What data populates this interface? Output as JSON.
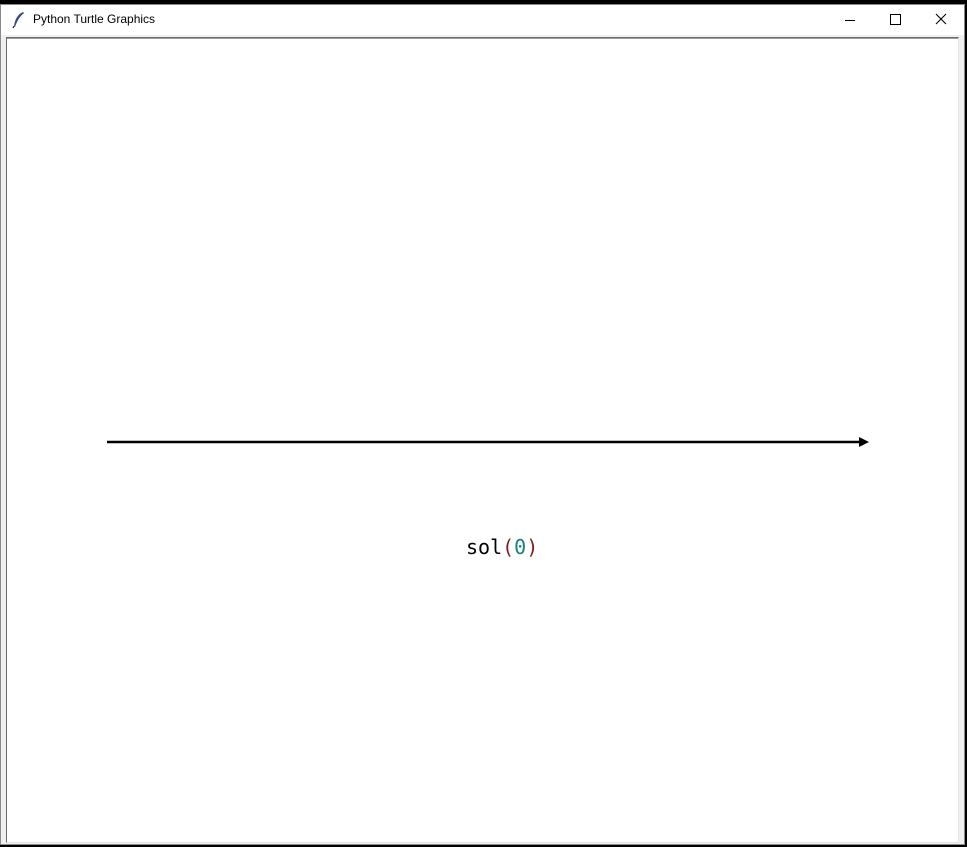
{
  "window": {
    "title": "Python Turtle Graphics",
    "icon": "feather-icon",
    "controls": {
      "minimize_icon": "minimize-icon",
      "maximize_icon": "maximize-icon",
      "close_icon": "close-icon"
    }
  },
  "canvas": {
    "background": "#ffffff",
    "arrow_color": "#000000",
    "label": {
      "name": "sol",
      "open_paren": "(",
      "argument": "0",
      "close_paren": ")"
    },
    "colors": {
      "name": "#000000",
      "paren": "#7f1f1f",
      "number": "#1a7f7f"
    }
  }
}
